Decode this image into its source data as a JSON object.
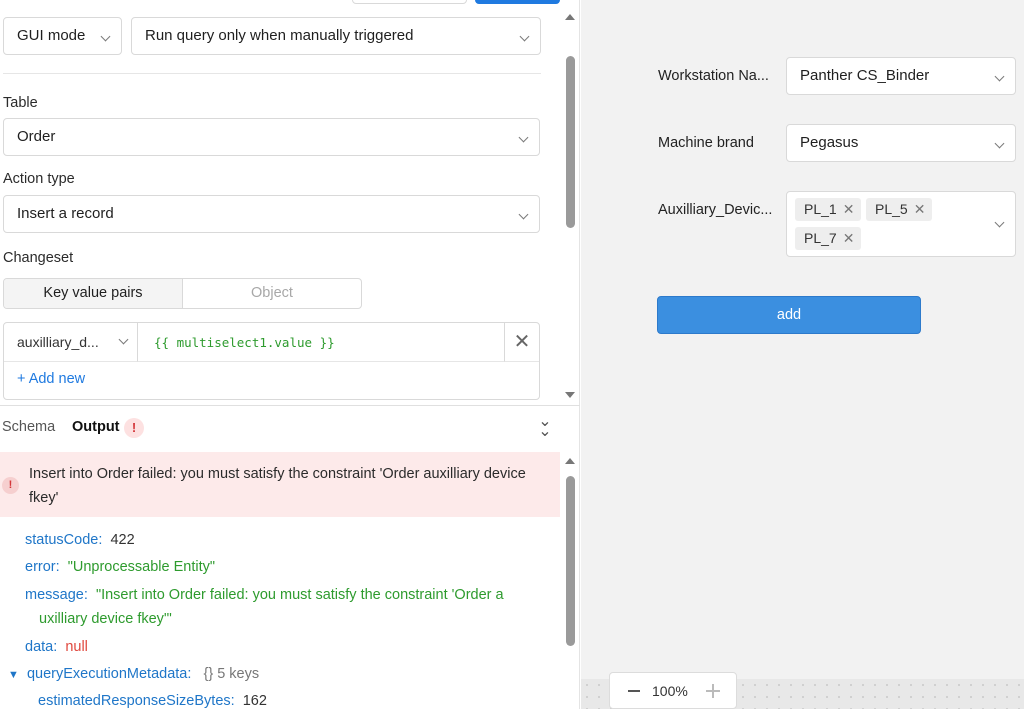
{
  "editor": {
    "mode": "GUI mode",
    "trigger": "Run query only when manually triggered",
    "table_label": "Table",
    "table_value": "Order",
    "action_label": "Action type",
    "action_value": "Insert a record",
    "changeset_label": "Changeset",
    "changeset_tabs": [
      "Key value pairs",
      "Object"
    ],
    "kv_key": "auxilliary_d...",
    "kv_value": "{{ multiselect1.value }}",
    "kv_delete": "✕",
    "add_new": "+ Add new"
  },
  "output": {
    "tabs": [
      "Schema",
      "Output"
    ],
    "badge": "!",
    "error_message": "Insert into Order failed: you must satisfy the constraint 'Order auxilliary device fkey'",
    "rows": {
      "status_key": "statusCode:",
      "status_val": "422",
      "error_key": "error:",
      "error_val": "\"Unprocessable Entity\"",
      "message_key": "message:",
      "message_line1": "\"Insert into Order failed: you must satisfy the constraint 'Order a",
      "message_line2": "uxilliary device fkey'\"",
      "data_key": "data:",
      "data_val": "null",
      "meta_key": "queryExecutionMetadata:",
      "meta_info": "{}  5 keys",
      "size_key": "estimatedResponseSizeBytes:",
      "size_val": "162"
    }
  },
  "form": {
    "workstation_label": "Workstation Na...",
    "workstation_value": "Panther CS_Binder",
    "brand_label": "Machine brand",
    "brand_value": "Pegasus",
    "aux_label": "Auxilliary_Devic...",
    "aux_chips": [
      "PL_1",
      "PL_5",
      "PL_7"
    ],
    "add_button": "add"
  },
  "zoom": {
    "level": "100%"
  }
}
